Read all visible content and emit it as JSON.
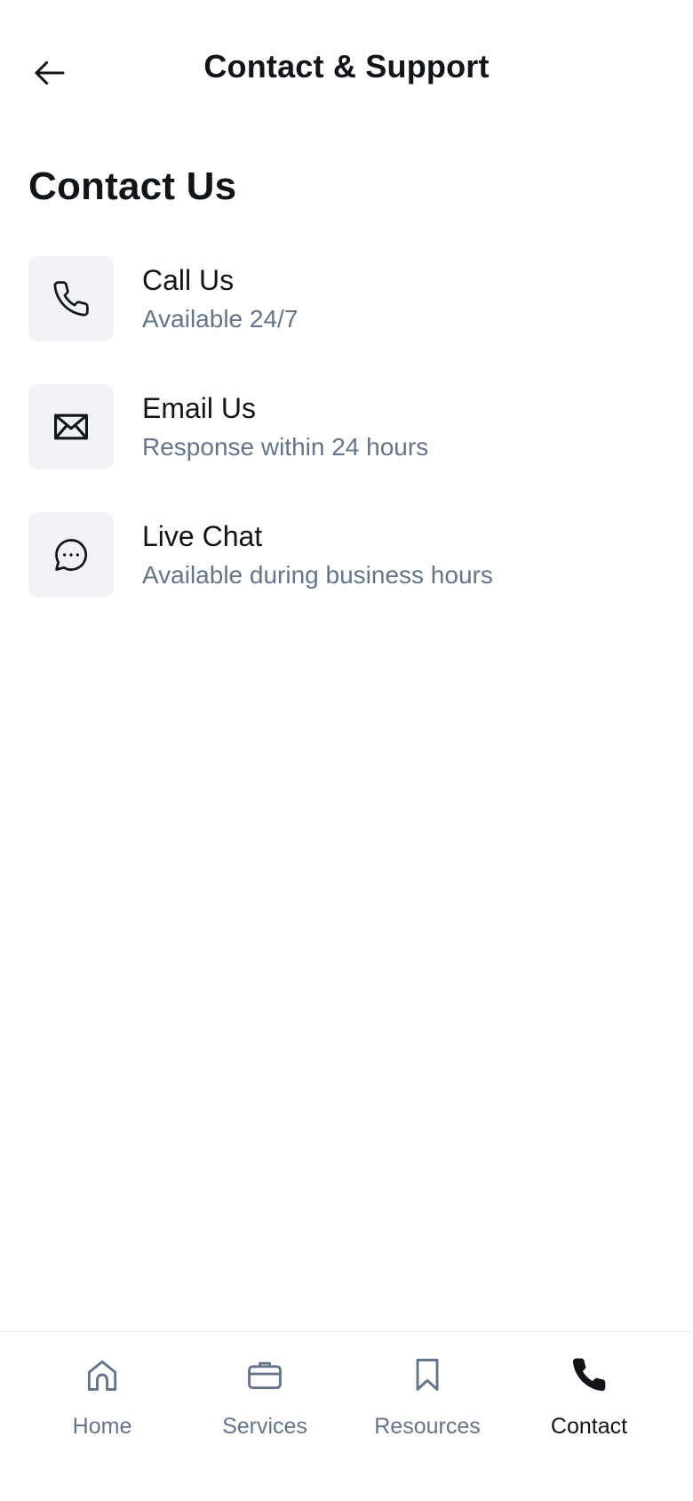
{
  "header": {
    "title": "Contact & Support",
    "back_icon": "arrow-left-icon"
  },
  "section": {
    "title": "Contact Us"
  },
  "contacts": [
    {
      "title": "Call Us",
      "subtitle": "Available 24/7",
      "icon": "phone-icon"
    },
    {
      "title": "Email Us",
      "subtitle": "Response within 24 hours",
      "icon": "mail-icon"
    },
    {
      "title": "Live Chat",
      "subtitle": "Available during business hours",
      "icon": "chat-bubble-icon"
    }
  ],
  "bottom_nav": {
    "items": [
      {
        "label": "Home",
        "icon": "home-icon",
        "active": false
      },
      {
        "label": "Services",
        "icon": "briefcase-icon",
        "active": false
      },
      {
        "label": "Resources",
        "icon": "bookmark-icon",
        "active": false
      },
      {
        "label": "Contact",
        "icon": "phone-filled-icon",
        "active": true
      }
    ]
  },
  "colors": {
    "text_primary": "#111418",
    "text_secondary": "#647489",
    "icon_tile_bg": "#f1f2f5",
    "nav_inactive": "#647489",
    "nav_active": "#111418"
  }
}
